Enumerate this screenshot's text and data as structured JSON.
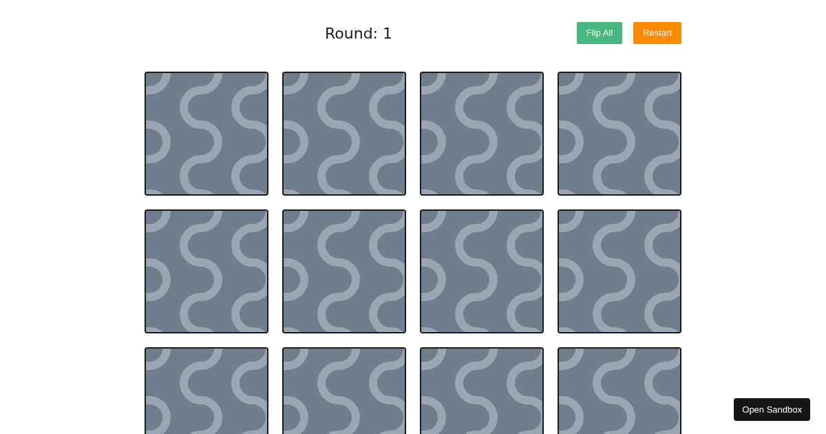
{
  "header": {
    "title": "Round: 1",
    "buttons": [
      {
        "label": "Flip All",
        "kind": "flip"
      },
      {
        "label": "Restart",
        "kind": "restart"
      }
    ]
  },
  "cards": [
    {
      "flipped": false
    },
    {
      "flipped": false
    },
    {
      "flipped": false
    },
    {
      "flipped": false
    },
    {
      "flipped": false
    },
    {
      "flipped": false
    },
    {
      "flipped": false
    },
    {
      "flipped": false
    },
    {
      "flipped": false
    },
    {
      "flipped": false
    },
    {
      "flipped": false
    },
    {
      "flipped": false
    }
  ],
  "sandbox_button": {
    "label": "Open Sandbox"
  }
}
